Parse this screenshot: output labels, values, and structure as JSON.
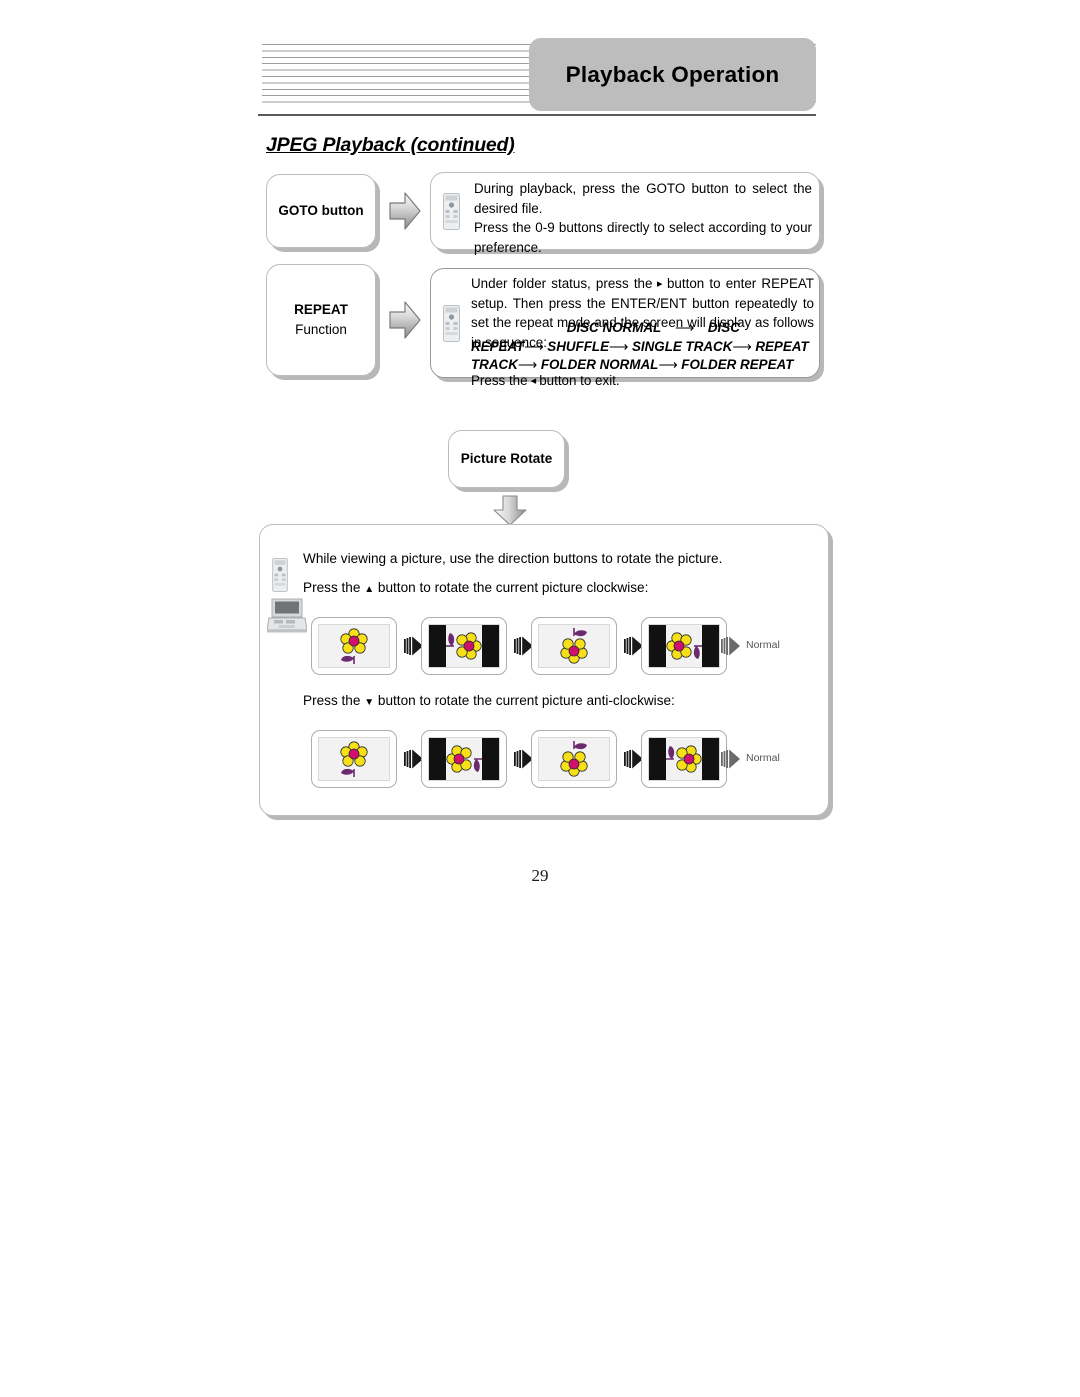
{
  "header": {
    "chapter_title": "Playback Operation",
    "section_title": "JPEG Playback (continued)"
  },
  "blocks": [
    {
      "label": "GOTO button",
      "icon": "remote-control-icon",
      "lines": [
        "During playback, press the GOTO button to select the desired file.",
        "Press the 0-9 buttons directly to select according to your preference."
      ]
    },
    {
      "label_line1": "REPEAT",
      "label_line2": "Function",
      "icon": "remote-control-icon",
      "text_intro": "Under folder status, press the",
      "text_after_right_arrow": "button to enter REPEAT setup. Then press the ENTER/ENT button repeatedly to set the repeat mode and the screen will display as follows in sequence:",
      "sequence": [
        "DISC NORMAL",
        "DISC REPEAT",
        "SHUFFLE",
        "SINGLE TRACK",
        "REPEAT TRACK",
        "FOLDER NORMAL",
        "FOLDER REPEAT"
      ],
      "text_exit_before": "Press the",
      "text_exit_after": "button to exit."
    }
  ],
  "picture_rotate": {
    "label": "Picture Rotate",
    "intro": "While viewing a picture, use the direction buttons to rotate the picture.",
    "clockwise_before": "Press the",
    "clockwise_after": "button to rotate the current picture clockwise:",
    "anticlockwise_before": "Press the",
    "anticlockwise_after": "button to rotate the current picture anti-clockwise:",
    "end_label": "Normal",
    "icons": [
      "remote-control-icon",
      "portable-dvd-player-icon"
    ],
    "clockwise_steps": [
      {
        "rotation": 0,
        "letterbox": false
      },
      {
        "rotation": 90,
        "letterbox": true
      },
      {
        "rotation": 180,
        "letterbox": false
      },
      {
        "rotation": 270,
        "letterbox": true
      }
    ],
    "anticlockwise_steps": [
      {
        "rotation": 0,
        "letterbox": false
      },
      {
        "rotation": -90,
        "letterbox": true
      },
      {
        "rotation": -180,
        "letterbox": false
      },
      {
        "rotation": -270,
        "letterbox": true
      }
    ]
  },
  "page_number": "29",
  "colors": {
    "header_tab_bg": "#bdbdbd",
    "rule": "#5a5a5a",
    "box_border": "#bcbcbc",
    "box_shadow": "#b8b8b8",
    "flower_petal": "#f7e018",
    "flower_center": "#d10f6e",
    "flower_leaf": "#6c2a6e",
    "letterbox_bar": "#111111"
  }
}
